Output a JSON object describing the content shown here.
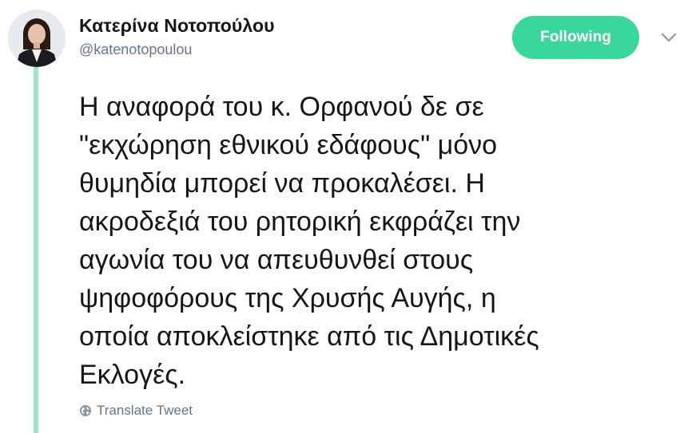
{
  "author": {
    "display_name": "Κατερίνα Νοτοπούλου",
    "handle": "@katenotopoulou"
  },
  "follow_button": {
    "label": "Following",
    "color": "#3ad79d"
  },
  "menu": {
    "icon": "chevron-down-icon"
  },
  "tweet": {
    "lines": [
      "Η αναφορά του κ. Ορφανού δε σε",
      "\"εκχώρηση εθνικού εδάφους\" μόνο",
      "θυμηδία μπορεί να προκαλέσει. Η",
      "ακροδεξιά του ρητορική εκφράζει την",
      "αγωνία του να απευθυνθεί στους",
      "ψηφοφόρους της Χρυσής Αυγής, η",
      "οποία αποκλείστηκε από τις Δημοτικές",
      "Εκλογές."
    ]
  },
  "translate": {
    "label": "Translate Tweet",
    "icon": "globe-icon"
  },
  "colors": {
    "thread_line": "#9fe5c8",
    "secondary_text": "#657786"
  }
}
